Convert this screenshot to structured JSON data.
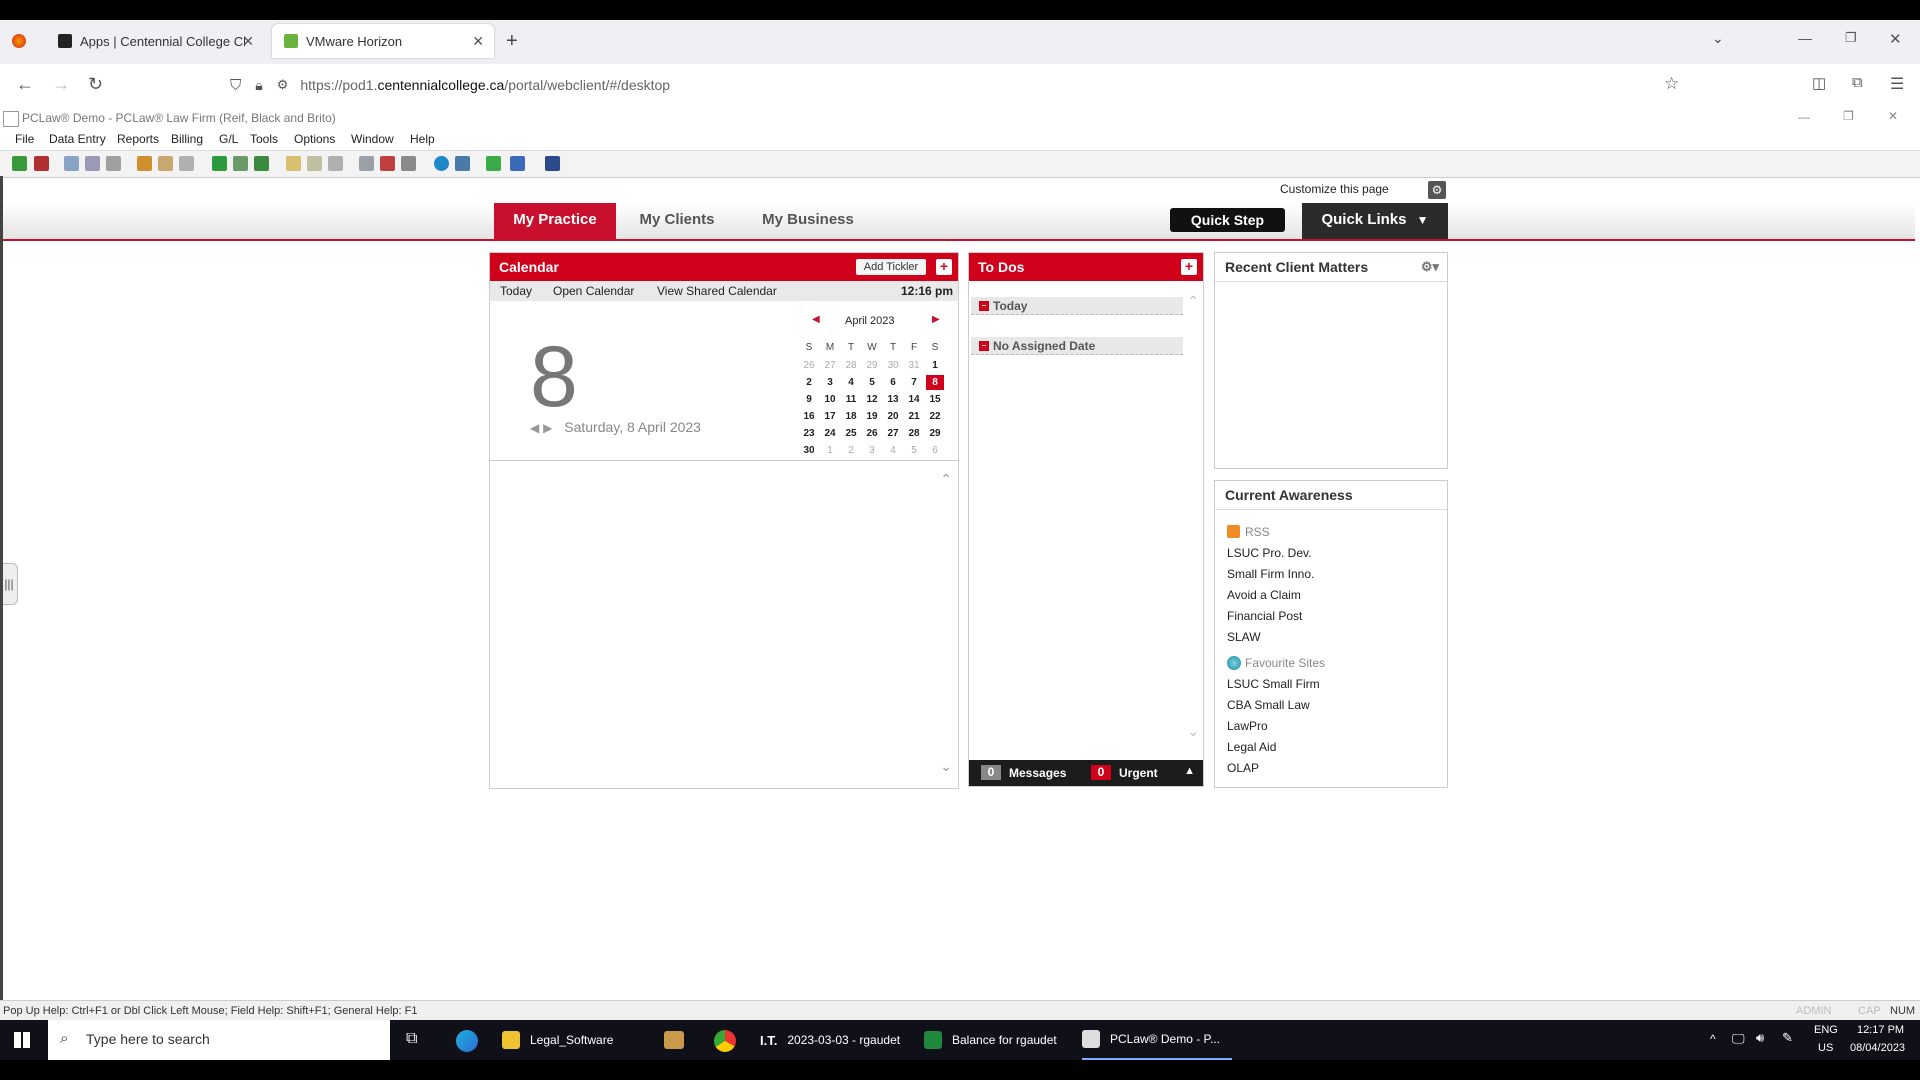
{
  "browser": {
    "tabs": [
      {
        "label": "Apps | Centennial College Clas",
        "active": false
      },
      {
        "label": "VMware Horizon",
        "active": true
      }
    ],
    "url_prefix": "https://pod1.",
    "url_domain": "centennialcollege.ca",
    "url_suffix": "/portal/webclient/#/desktop"
  },
  "app": {
    "title": "PCLaw® Demo - PCLaw® Law Firm (Reif, Black and Brito)",
    "menu": [
      "File",
      "Data Entry",
      "Reports",
      "Billing",
      "G/L",
      "Tools",
      "Options",
      "Window",
      "Help"
    ]
  },
  "page": {
    "customize": "Customize this page",
    "tabs": [
      "My Practice",
      "My Clients",
      "My Business"
    ],
    "quick_step": "Quick Step",
    "quick_links": "Quick Links"
  },
  "calendar": {
    "title": "Calendar",
    "add_tickler": "Add Tickler",
    "today_btn": "Today",
    "open_btn": "Open Calendar",
    "shared_btn": "View Shared Calendar",
    "time": "12:16 pm",
    "big_day": "8",
    "date_line": "Saturday, 8 April 2023",
    "month": "April 2023",
    "dow": [
      "S",
      "M",
      "T",
      "W",
      "T",
      "F",
      "S"
    ],
    "weeks": [
      [
        "26",
        "27",
        "28",
        "29",
        "30",
        "31",
        "1"
      ],
      [
        "2",
        "3",
        "4",
        "5",
        "6",
        "7",
        "8"
      ],
      [
        "9",
        "10",
        "11",
        "12",
        "13",
        "14",
        "15"
      ],
      [
        "16",
        "17",
        "18",
        "19",
        "20",
        "21",
        "22"
      ],
      [
        "23",
        "24",
        "25",
        "26",
        "27",
        "28",
        "29"
      ],
      [
        "30",
        "1",
        "2",
        "3",
        "4",
        "5",
        "6"
      ]
    ]
  },
  "todos": {
    "title": "To Dos",
    "groups": [
      "Today",
      "No Assigned Date"
    ],
    "messages_count": "0",
    "messages_label": "Messages",
    "urgent_count": "0",
    "urgent_label": "Urgent"
  },
  "recent": {
    "title": "Recent Client Matters"
  },
  "awareness": {
    "title": "Current Awareness",
    "rss_label": "RSS",
    "rss_links": [
      "LSUC Pro. Dev.",
      "Small Firm Inno.",
      "Avoid a Claim",
      "Financial Post",
      "SLAW"
    ],
    "fav_label": "Favourite Sites",
    "fav_links": [
      "LSUC Small Firm",
      "CBA Small Law",
      "LawPro",
      "Legal Aid",
      "OLAP"
    ]
  },
  "status": {
    "help": "Pop Up Help: Ctrl+F1 or Dbl Click Left Mouse; Field Help: Shift+F1; General Help: F1",
    "right": [
      "ADMIN",
      "CAP",
      "NUM"
    ]
  },
  "taskbar": {
    "search": "Type here to search",
    "items": [
      "Legal_Software",
      "2023-03-03 - rgaudet",
      "Balance for rgaudet",
      "PCLaw® Demo - P..."
    ],
    "it_prefix": "I.T.",
    "lang": "ENG",
    "region": "US",
    "time": "12:17 PM",
    "date": "08/04/2023"
  }
}
